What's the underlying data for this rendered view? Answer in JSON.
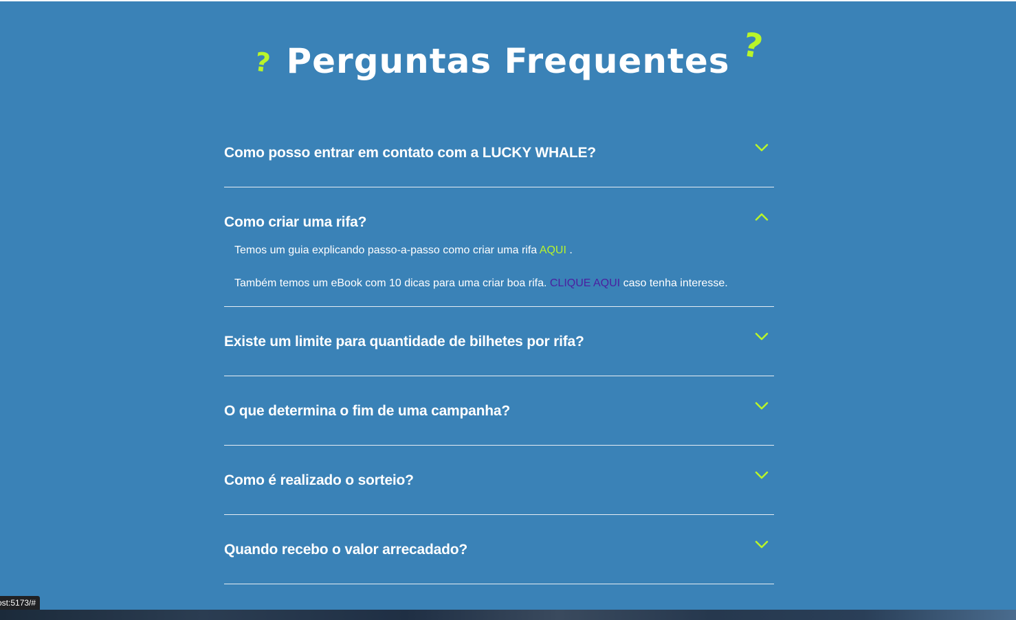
{
  "faq": {
    "title": "Perguntas Frequentes",
    "title_left_mark": "?",
    "title_right_mark": "?",
    "items": [
      {
        "question": "Como posso entrar em contato com a LUCKY WHALE?",
        "state": "collapsed",
        "chevron": "chevron-down-icon"
      },
      {
        "question": "Como criar uma rifa?",
        "state": "expanded",
        "chevron": "chevron-up-icon"
      },
      {
        "question": "Existe um limite para quantidade de bilhetes por rifa?",
        "state": "collapsed",
        "chevron": "chevron-down-icon"
      },
      {
        "question": "O que determina o fim de uma campanha?",
        "state": "collapsed",
        "chevron": "chevron-down-icon"
      },
      {
        "question": "Como é realizado o sorteio?",
        "state": "collapsed",
        "chevron": "chevron-down-icon"
      },
      {
        "question": "Quando recebo o valor arrecadado?",
        "state": "collapsed",
        "chevron": "chevron-down-icon"
      }
    ],
    "answer": {
      "line1_text": "Temos um guia explicando passo-a-passo como criar uma rifa",
      "line1_link": "AQUI",
      "line1_end": ".",
      "line2_text": "Também temos um eBook com 10 dicas para uma criar boa rifa.",
      "line2_link": "CLIQUE AQUI",
      "line2_end": "caso tenha interesse."
    }
  },
  "status_bar": {
    "url": "ost:5173/#"
  },
  "colors": {
    "background": "#3a82b7",
    "accent": "#b9f52a",
    "link_visited": "#4b1fa0",
    "text": "#ffffff"
  }
}
